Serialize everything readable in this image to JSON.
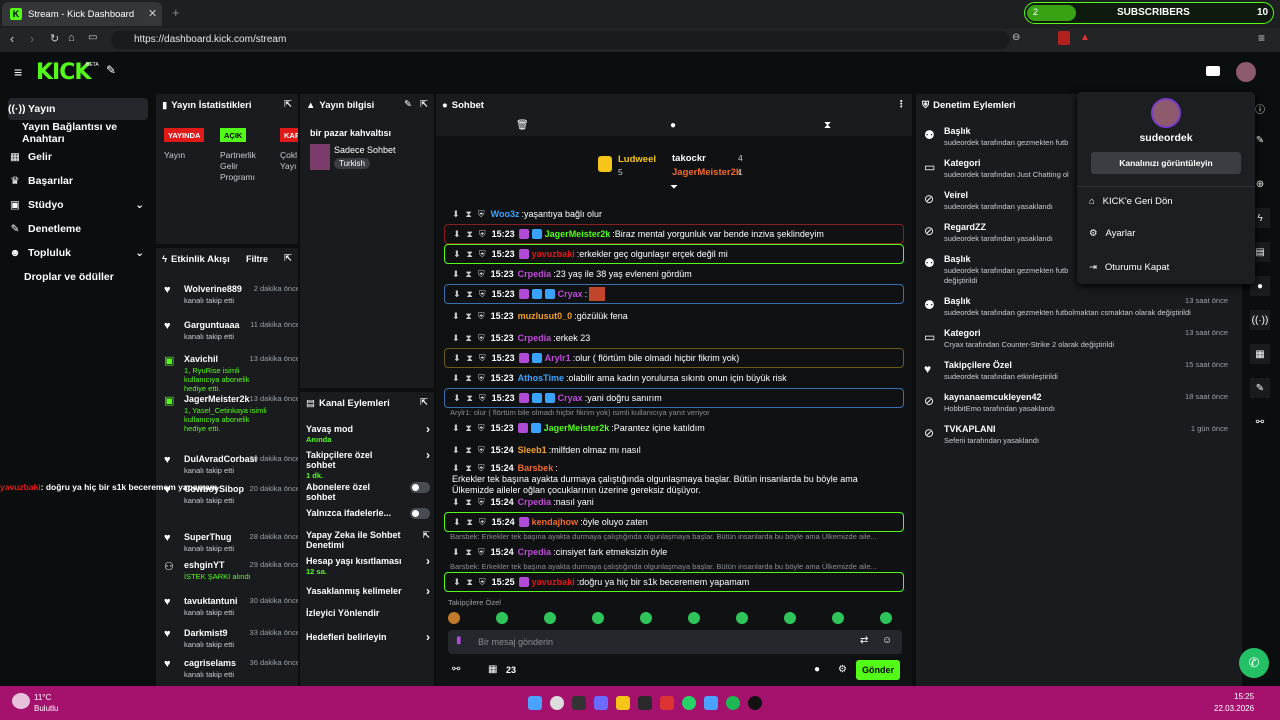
{
  "browser": {
    "tab_title": "Stream - Kick Dashboard",
    "url": "https://dashboard.kick.com/stream",
    "widget": {
      "progress_label": "2",
      "title": "SUBSCRIBERS",
      "count": "10",
      "fill_fraction": 0.2
    }
  },
  "brand": {
    "logo": "KICK",
    "beta": "BETA",
    "accent": "#53fc18"
  },
  "sidebar": {
    "items": [
      {
        "label": "Yayın",
        "icon": "broadcast-icon",
        "active": true
      },
      {
        "label": "Yayın Bağlantısı ve Anahtarı",
        "icon": "",
        "active": false
      },
      {
        "label": "Gelir",
        "icon": "revenue-icon"
      },
      {
        "label": "Başarılar",
        "icon": "trophy-icon"
      },
      {
        "label": "Stüdyo",
        "icon": "studio-icon",
        "expandable": true
      },
      {
        "label": "Denetleme",
        "icon": "wrench-icon"
      },
      {
        "label": "Topluluk",
        "icon": "community-icon",
        "expandable": true
      },
      {
        "label": "Droplar ve ödüller",
        "icon": ""
      }
    ]
  },
  "stats": {
    "title": "Yayın İstatistikleri",
    "badges": [
      {
        "badge": "YAYINDA",
        "label": "Yayın",
        "color": "#e01919"
      },
      {
        "badge": "AÇIK",
        "label": "Partnerlik Gelir Programı",
        "color": "#53fc18"
      },
      {
        "badge": "KAP",
        "label": "Çokl Yayı",
        "color": "#e01919"
      }
    ]
  },
  "info": {
    "title": "Yayın bilgisi",
    "stream_title": "bir pazar kahvaltısı",
    "category": "Sadece Sohbet",
    "language": "Turkish"
  },
  "feed": {
    "title": "Etkinlik Akışı",
    "filter": "Filtre",
    "items": [
      {
        "name": "Wolverine889",
        "sub": "kanalı takip etti",
        "time": "2 dakika önce",
        "kind": "follow"
      },
      {
        "name": "Garguntuaaa",
        "sub": "kanalı takip etti",
        "time": "11 dakika önce",
        "kind": "follow"
      },
      {
        "name": "Xavichil",
        "sub": "1, RyuRise isimli kullanıcıya abonelik hediye etti.",
        "time": "13 dakika önce",
        "kind": "gift"
      },
      {
        "name": "JagerMeister2k",
        "sub": "1, Yasel_Cetinkaya isimli kullanıcıya abonelik hediye etti.",
        "time": "13 dakika önce",
        "kind": "gift"
      },
      {
        "name": "DulAvradCorbasi",
        "sub": "kanalı takip etti",
        "time": "20 dakika önce",
        "kind": "follow"
      },
      {
        "name": "CowboySibop",
        "sub": "kanalı takip etti",
        "time": "20 dakika önce",
        "kind": "follow"
      },
      {
        "name": "SuperThug",
        "sub": "kanalı takip etti",
        "time": "28 dakika önce",
        "kind": "follow"
      },
      {
        "name": "eshginYT",
        "sub": "İSTEK ŞARKI alındı",
        "time": "29 dakika önce",
        "kind": "reward"
      },
      {
        "name": "tavuktantuni",
        "sub": "kanalı takip etti",
        "time": "30 dakika önce",
        "kind": "follow"
      },
      {
        "name": "Darkmist9",
        "sub": "kanalı takip etti",
        "time": "33 dakika önce",
        "kind": "follow"
      },
      {
        "name": "cagriselams",
        "sub": "kanalı takip etti",
        "time": "36 dakika önce",
        "kind": "follow"
      }
    ]
  },
  "actions": {
    "title": "Kanal Eylemleri",
    "rows": [
      {
        "label": "Yavaş mod",
        "sub": "Anında",
        "ctl": "arrow"
      },
      {
        "label": "Takipçilere özel sohbet",
        "sub": "1 dk.",
        "ctl": "arrow"
      },
      {
        "label": "Abonelere özel sohbet",
        "sub": "",
        "ctl": "toggle"
      },
      {
        "label": "Yalnızca ifadelerle...",
        "sub": "",
        "ctl": "toggle"
      },
      {
        "label": "Yapay Zeka ile Sohbet Denetimi",
        "sub": "",
        "ctl": "ext"
      },
      {
        "label": "Hesap yaşı kısıtlaması",
        "sub": "12 sa.",
        "ctl": "arrow"
      },
      {
        "label": "Yasaklanmış kelimeler",
        "sub": "",
        "ctl": "arrow"
      },
      {
        "label": "İzleyici Yönlendir",
        "sub": "",
        "ctl": "none"
      },
      {
        "label": "Hedefleri belirleyin",
        "sub": "",
        "ctl": "arrow"
      }
    ]
  },
  "chat": {
    "title": "Sohbet",
    "leaders": [
      {
        "name": "Ludweel",
        "count": "5"
      },
      {
        "name": "takockr",
        "count": "4"
      },
      {
        "name": "JagerMeister2k",
        "count": "1"
      }
    ],
    "messages": [
      {
        "time": "",
        "user": "Woo3z",
        "color": "#3aa3ff",
        "text": "yaşantıya bağlı olur",
        "hl": "",
        "badges": 0
      },
      {
        "time": "15:23",
        "user": "JagerMeister2k",
        "color": "#53fc18",
        "text": "Biraz mental yorgunluk var bende inziva şeklindeyim",
        "hl": "hr",
        "badges": 2
      },
      {
        "time": "15:23",
        "user": "yavuzbaki",
        "color": "#e01919",
        "text": "erkekler geç olgunlaşır erçek değil mi",
        "hl": "hl",
        "badges": 1
      },
      {
        "time": "15:23",
        "user": "Crpedia",
        "color": "#c04bd8",
        "text": "23 yaş ile 38 yaş evleneni gördüm",
        "hl": "",
        "badges": 0
      },
      {
        "time": "15:23",
        "user": "Cryax",
        "color": "#c04bd8",
        "text": "",
        "hl": "hb",
        "badges": 3
      },
      {
        "time": "15:23",
        "user": "muzlusut0_0",
        "color": "#f0a030",
        "text": "gözülük fena",
        "hl": "",
        "badges": 0
      },
      {
        "time": "15:23",
        "user": "Crpedia",
        "color": "#c04bd8",
        "text": "erkek 23",
        "hl": "",
        "badges": 0
      },
      {
        "time": "15:23",
        "user": "Arylr1",
        "color": "#c04bd8",
        "text": "olur ( flörtüm bile olmadı hiçbir fikrim yok)",
        "hl": "hy",
        "badges": 2
      },
      {
        "time": "15:23",
        "user": "AthosTime",
        "color": "#3aa3ff",
        "text": "olabilir ama kadın yorulursa sıkıntı onun için büyük risk",
        "hl": "",
        "badges": 0
      },
      {
        "time": "15:23",
        "user": "Cryax",
        "color": "#c04bd8",
        "text": "yani doğru sanırım",
        "hl": "hb",
        "badges": 3
      },
      {
        "time": "15:23",
        "user": "JagerMeister2k",
        "color": "#53fc18",
        "text": "Parantez içine katıldım",
        "hl": "",
        "badges": 2
      },
      {
        "time": "15:24",
        "user": "Sleeb1",
        "color": "#f0a030",
        "text": "milfden olmaz mı nasıl",
        "hl": "",
        "badges": 0
      },
      {
        "time": "15:24",
        "user": "Barsbek",
        "color": "#f06a30",
        "text": "Erkekler tek başına ayakta durmaya çalıştığında olgunlaşmaya başlar. Bütün insanlarda bu böyle ama Ülkemizde aileler oğlan çocuklarının üzerine gereksiz düşüyor.",
        "hl": "",
        "badges": 0
      },
      {
        "time": "15:24",
        "user": "Crpedia",
        "color": "#c04bd8",
        "text": "nasıl yani",
        "hl": "",
        "badges": 0
      },
      {
        "time": "15:24",
        "user": "kendajhow",
        "color": "#f06a30",
        "text": "öyle oluyo zaten",
        "hl": "hl",
        "badges": 1
      },
      {
        "time": "15:24",
        "user": "Crpedia",
        "color": "#c04bd8",
        "text": "cinsiyet fark etmeksizin öyle",
        "hl": "",
        "badges": 0
      },
      {
        "time": "15:25",
        "user": "yavuzbaki",
        "color": "#e01919",
        "text": "doğru ya hiç bir s1k beceremem yapamam",
        "hl": "hl",
        "badges": 1
      }
    ],
    "replies": [
      "Arylr1: olur ( flörtüm bile olmadı hiçbir fikrim yok) isimli kullanıcıya yanıt veriyor",
      "Barsbek: Erkekler tek başına ayakta durmaya çalıştığında olgunlaşmaya başlar. Bütün insanlarda bu böyle ama Ülkemizde aile...",
      "Barsbek: Erkekler tek başına ayakta durmaya çalıştığında olgunlaşmaya başlar. Bütün insanlarda bu böyle ama Ülkemizde aile..."
    ],
    "followers_only": "Takipçilere Özel",
    "input_placeholder": "Bir mesaj gönderin",
    "viewers": "23",
    "send": "Gönder",
    "overlay_user": "yavuzbaki",
    "overlay_text": "doğru ya hiç bir s1k beceremem yapamam"
  },
  "mod": {
    "title": "Denetim Eylemleri",
    "items": [
      {
        "title": "Başlık",
        "sub": "sudeordek tarafından gezmekten futb",
        "time": "",
        "icon": "title-icon"
      },
      {
        "title": "Kategori",
        "sub": "sudeordek tarafından Just Chatting ol",
        "time": "",
        "icon": "category-icon"
      },
      {
        "title": "Veirel",
        "sub": "sudeordek tarafından yasaklandı",
        "time": "",
        "icon": "ban-icon"
      },
      {
        "title": "RegardZZ",
        "sub": "sudeordek tarafından yasaklandı",
        "time": "",
        "icon": "ban-icon"
      },
      {
        "title": "Başlık",
        "sub": "sudeordek tarafından gezmekten futb",
        "sub2": "değiştirildi",
        "time": "",
        "icon": "title-icon"
      },
      {
        "title": "Başlık",
        "sub": "sudeordek tarafından gezmekten futbolmaktan csmaktan olarak değiştirildi",
        "time": "13 saat önce",
        "icon": "title-icon"
      },
      {
        "title": "Kategori",
        "sub": "Cryax tarafından Counter-Strike 2 olarak değiştirildi",
        "time": "13 saat önce",
        "icon": "category-icon"
      },
      {
        "title": "Takipçilere Özel",
        "sub": "sudeordek tarafından etkinleştirildi",
        "time": "15 saat önce",
        "icon": "heart-icon"
      },
      {
        "title": "kaynanaemcukleyen42",
        "sub": "HobbitEmo tarafından yasaklandı",
        "time": "18 saat önce",
        "icon": "ban-icon"
      },
      {
        "title": "TVKAPLANI",
        "sub": "Seferii tarafından yasaklandı",
        "time": "1 gün önce",
        "icon": "ban-icon"
      }
    ]
  },
  "menu": {
    "user": "sudeordek",
    "view_channel": "Kanalınızı görüntüleyin",
    "items": [
      "KICK'e Geri Dön",
      "Ayarlar",
      "Oturumu Kapat"
    ]
  },
  "taskbar": {
    "temp": "11°C",
    "weather": "Bulutlu",
    "time": "15:25",
    "date": "22.03.2026"
  }
}
